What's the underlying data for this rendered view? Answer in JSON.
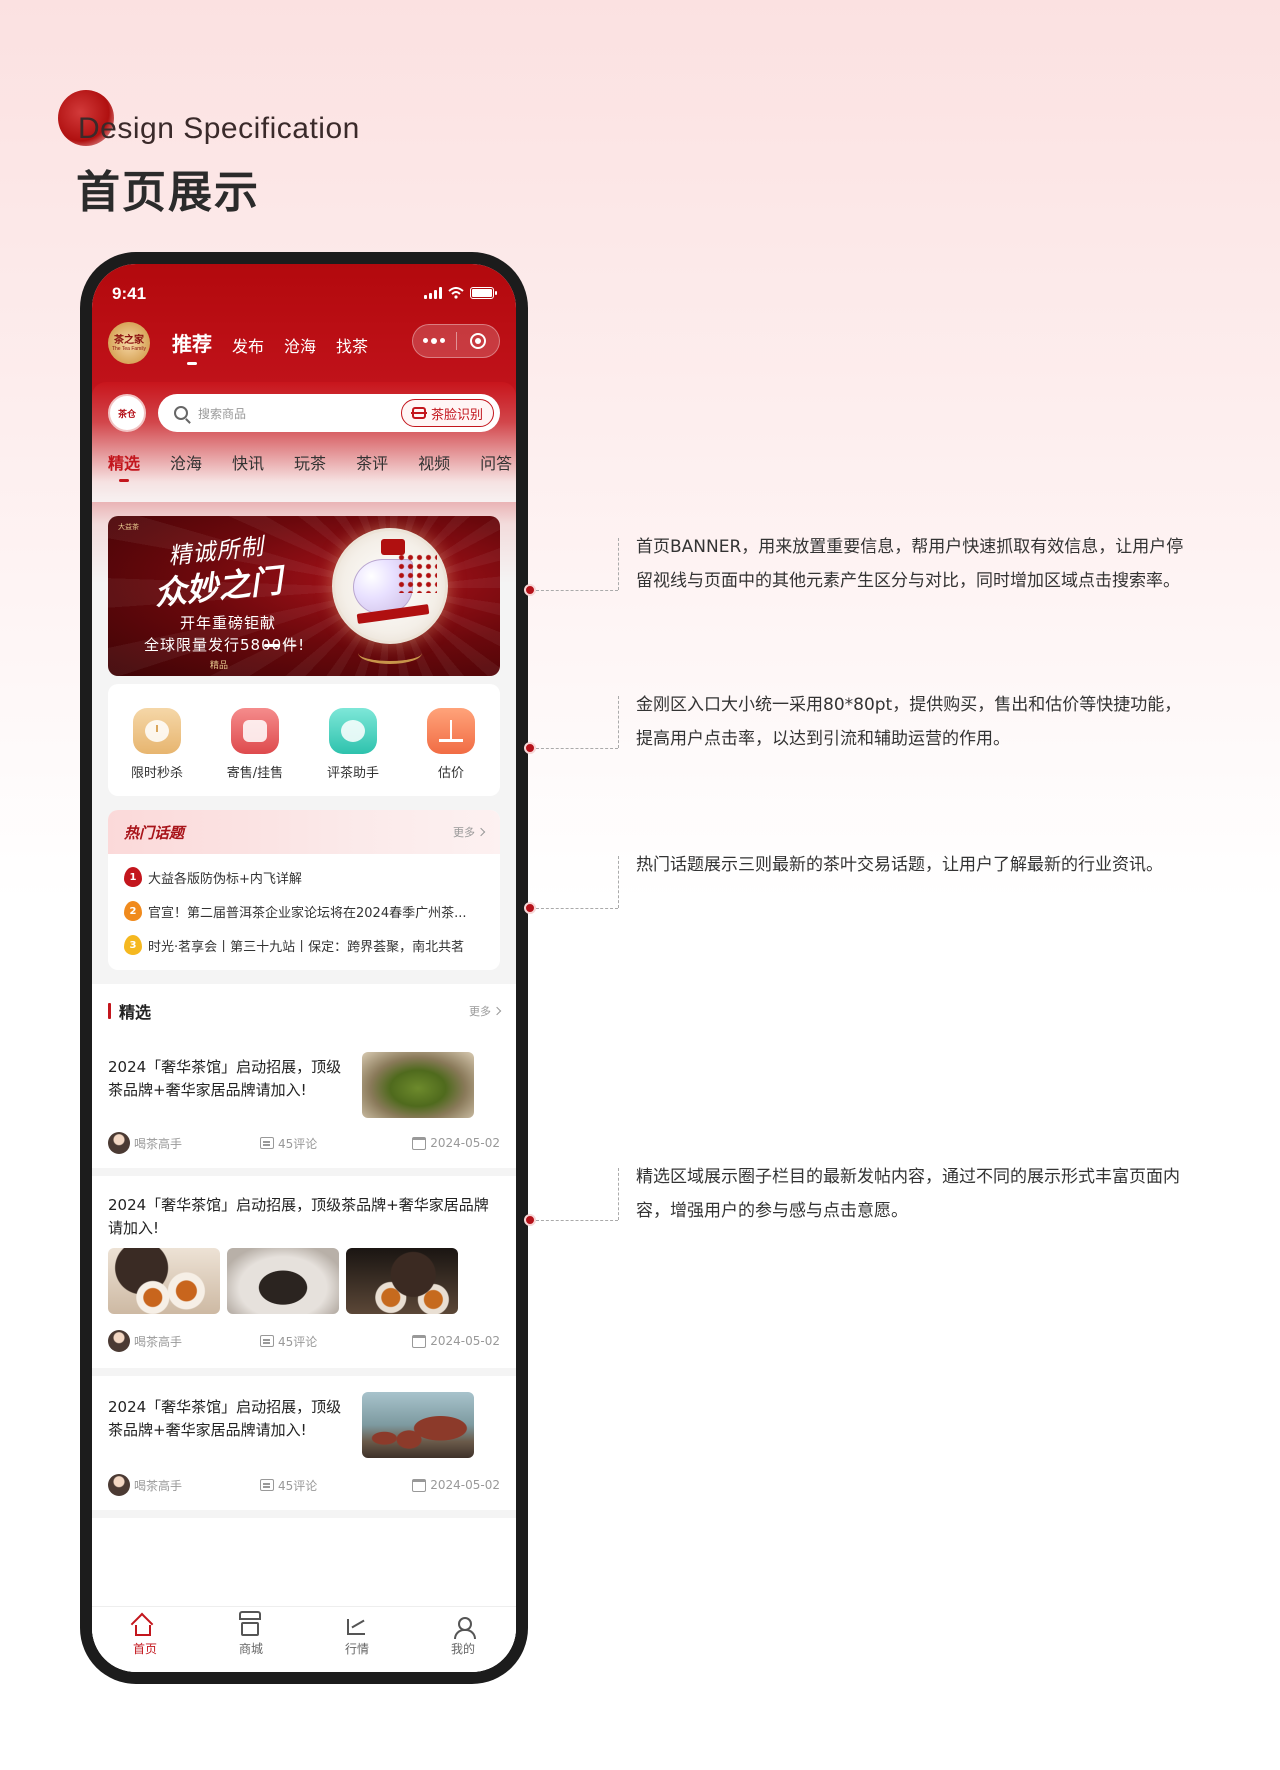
{
  "header": {
    "label_en": "Design Specification",
    "title": "首页展示"
  },
  "phone": {
    "status_bar": {
      "time": "9:41"
    },
    "nav": {
      "logo_text": "茶之家",
      "logo_sub": "The Tea Family",
      "tabs": [
        {
          "label": "推荐",
          "active": true
        },
        {
          "label": "发布",
          "active": false
        },
        {
          "label": "沧海",
          "active": false
        },
        {
          "label": "找茶",
          "active": false
        }
      ]
    },
    "search": {
      "small_logo": "茶仓",
      "placeholder": "搜索商品",
      "scan_label": "茶脸识别"
    },
    "categories": [
      {
        "label": "精选",
        "active": true
      },
      {
        "label": "沧海"
      },
      {
        "label": "快讯"
      },
      {
        "label": "玩茶"
      },
      {
        "label": "茶评"
      },
      {
        "label": "视频"
      },
      {
        "label": "问答"
      }
    ],
    "banner": {
      "brand": "大益茶",
      "calligraphy_line1": "精诚所制",
      "calligraphy_line2": "众妙之门",
      "line1": "开年重磅钜献",
      "line2": "全球限量发行5800件!",
      "tag": "精品",
      "slide_count": 3,
      "active_slide": 1
    },
    "quick_entries": [
      {
        "label": "限时秒杀",
        "icon": "alarm-clock-icon",
        "color": "#e7b56f"
      },
      {
        "label": "寄售/挂售",
        "icon": "shopping-bag-icon",
        "color": "#de4a4d"
      },
      {
        "label": "评茶助手",
        "icon": "chat-bubble-icon",
        "color": "#2ec2ad"
      },
      {
        "label": "估价",
        "icon": "scale-icon",
        "color": "#f16c44"
      }
    ],
    "hot_topics": {
      "title": "热门话题",
      "more": "更多",
      "items": [
        {
          "rank": "1",
          "text": "大益各版防伪标+内飞详解",
          "color": "#c3161d"
        },
        {
          "rank": "2",
          "text": "官宣！第二届普洱茶企业家论坛将在2024春季广州茶...",
          "color": "#f08a1d"
        },
        {
          "rank": "3",
          "text": "时光·茗享会丨第三十九站丨保定：跨界荟聚，南北共茗",
          "color": "#f5b820"
        }
      ]
    },
    "featured": {
      "title": "精选",
      "more": "更多",
      "posts": [
        {
          "title": "2024「奢华茶馆」启动招展，顶级茶品牌+奢华家居品牌请加入!",
          "author": "喝茶高手",
          "comments": "45评论",
          "date": "2024-05-02",
          "image": "green-tea-photo"
        },
        {
          "title": "2024「奢华茶馆」启动招展，顶级茶品牌+奢华家居品牌请加入!",
          "author": "喝茶高手",
          "comments": "45评论",
          "date": "2024-05-02",
          "images": [
            "tea-pouring-photo",
            "dark-tea-leaves-photo",
            "teapot-cups-photo"
          ]
        },
        {
          "title": "2024「奢华茶馆」启动招展，顶级茶品牌+奢华家居品牌请加入!",
          "author": "喝茶高手",
          "comments": "45评论",
          "date": "2024-05-02",
          "image": "clay-teapot-photo"
        }
      ]
    },
    "tabbar": [
      {
        "label": "首页",
        "icon": "home-icon",
        "active": true
      },
      {
        "label": "商城",
        "icon": "store-icon",
        "active": false
      },
      {
        "label": "行情",
        "icon": "trend-chart-icon",
        "active": false
      },
      {
        "label": "我的",
        "icon": "user-icon",
        "active": false
      }
    ]
  },
  "annotations": [
    {
      "text": "首页BANNER，用来放置重要信息，帮用户快速抓取有效信息，让用户停留视线与页面中的其他元素产生区分与对比，同时增加区域点击搜索率。"
    },
    {
      "text": "金刚区入口大小统一采用80*80pt，提供购买，售出和估价等快捷功能，提高用户点击率，以达到引流和辅助运营的作用。"
    },
    {
      "text": "热门话题展示三则最新的茶叶交易话题，让用户了解最新的行业资讯。"
    },
    {
      "text": "精选区域展示圈子栏目的最新发帖内容，通过不同的展示形式丰富页面内容，增强用户的参与感与点击意愿。"
    }
  ],
  "colors": {
    "brand_red": "#c3161d",
    "dark_red": "#b3090d",
    "annotation_dot": "#b5121a"
  }
}
